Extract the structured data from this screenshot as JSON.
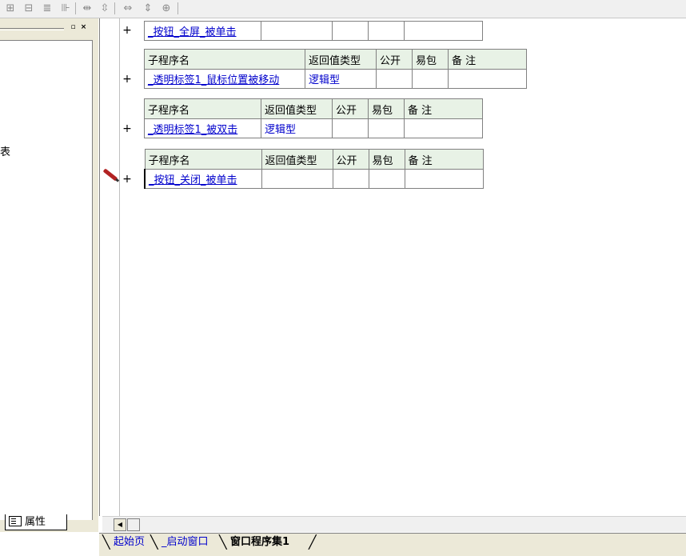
{
  "toolbar": {
    "icons": [
      "insert-row-icon",
      "insert-col-icon",
      "delete-row-icon",
      "delete-col-icon",
      "align-left-icon",
      "align-top-icon",
      "width-icon",
      "height-icon",
      "size-icon"
    ]
  },
  "left_panel": {
    "fragment_text": "表",
    "tab_label": "属性"
  },
  "editor": {
    "row0": {
      "name": "_按钮_全屏_被单击"
    },
    "tables": [
      {
        "headers": [
          "子程序名",
          "返回值类型",
          "公开",
          "易包",
          "备 注"
        ],
        "name": "_透明标签1_鼠标位置被移动",
        "return_type": "逻辑型"
      },
      {
        "headers": [
          "子程序名",
          "返回值类型",
          "公开",
          "易包",
          "备 注"
        ],
        "name": "_透明标签1_被双击",
        "return_type": "逻辑型"
      },
      {
        "headers": [
          "子程序名",
          "返回值类型",
          "公开",
          "易包",
          "备 注"
        ],
        "name": "_按钮_关闭_被单击",
        "return_type": ""
      }
    ],
    "plus_symbol": "+"
  },
  "bottom_tabs": [
    "起始页",
    "_启动窗口",
    "窗口程序集1"
  ]
}
